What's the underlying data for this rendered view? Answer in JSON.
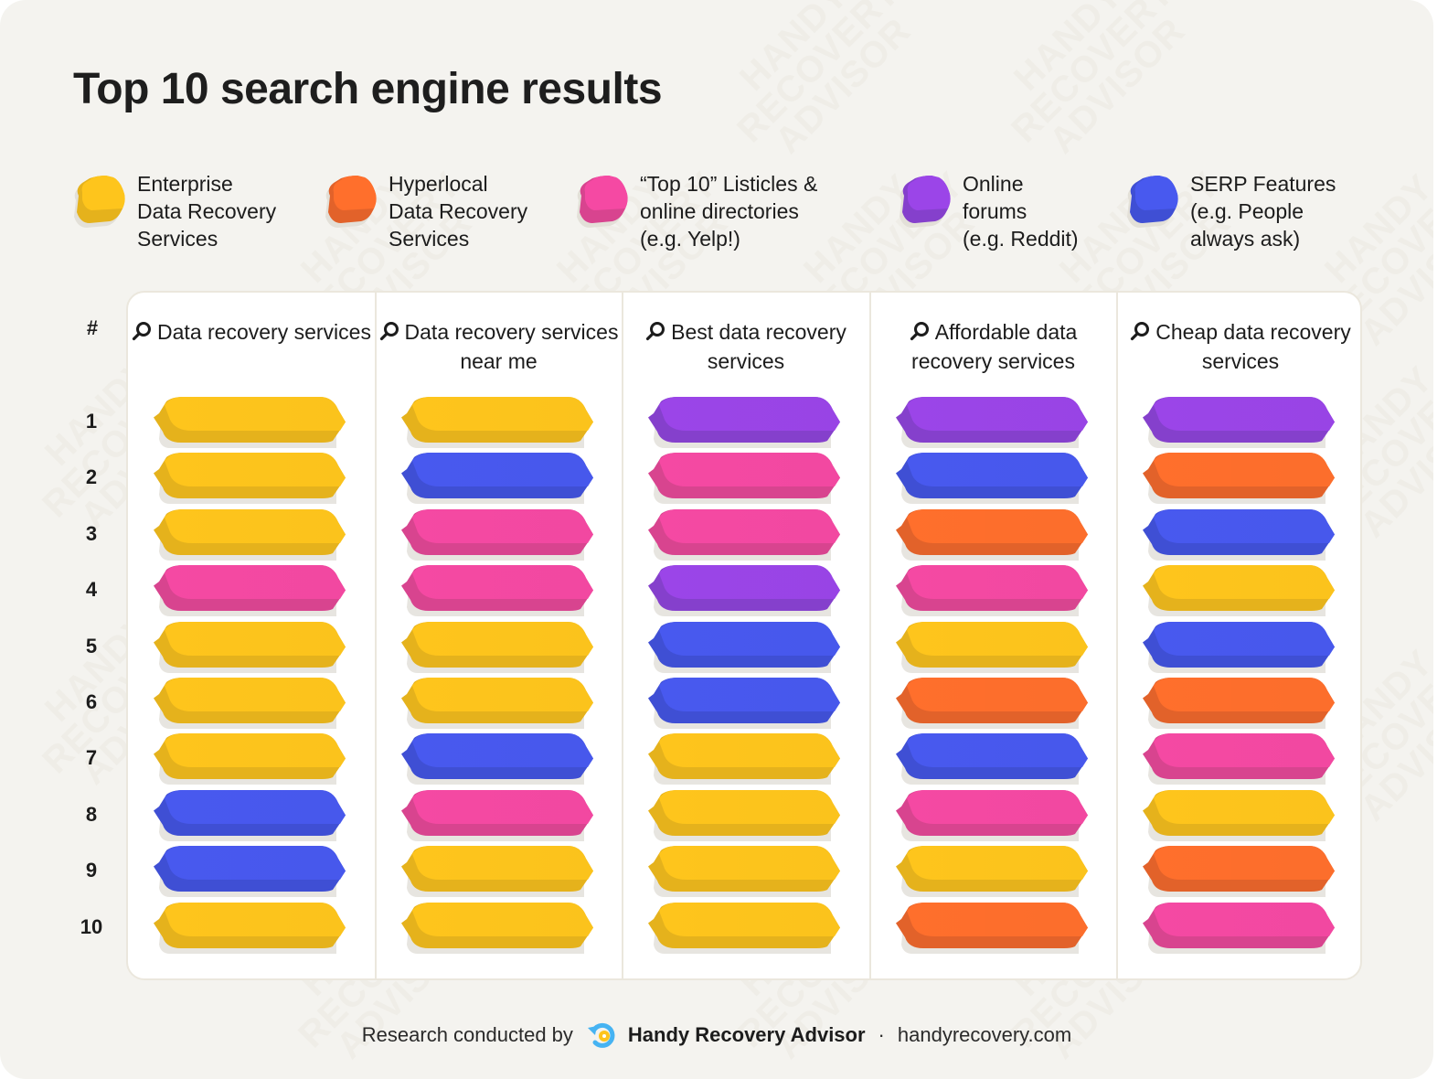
{
  "title": "Top 10 search engine results",
  "categories": {
    "enterprise": {
      "label": "Enterprise\nData Recovery\nServices",
      "color": "#fec51c",
      "shade": "#e5b21c"
    },
    "hyperlocal": {
      "label": "Hyperlocal\nData Recovery\nServices",
      "color": "#ff6f2c",
      "shade": "#e2622a"
    },
    "listicles": {
      "label": "“Top 10” Listicles &\nonline directories\n(e.g. Yelp!)",
      "color": "#f549a3",
      "shade": "#d8448f"
    },
    "forums": {
      "label": "Online\nforums\n(e.g. Reddit)",
      "color": "#9b45e8",
      "shade": "#8540cc"
    },
    "serp": {
      "label": "SERP Features\n(e.g. People\nalways ask)",
      "color": "#4859ef",
      "shade": "#3f4fd4"
    }
  },
  "legend_order": [
    "enterprise",
    "hyperlocal",
    "listicles",
    "forums",
    "serp"
  ],
  "rank_header": "#",
  "footer": {
    "prefix": "Research conducted by",
    "brand": "Handy Recovery Advisor",
    "separator": "·",
    "site": "handyrecovery.com"
  },
  "chart_data": {
    "type": "table",
    "title": "Top 10 search engine results",
    "row_label": "#",
    "rows": [
      "1",
      "2",
      "3",
      "4",
      "5",
      "6",
      "7",
      "8",
      "9",
      "10"
    ],
    "columns": [
      {
        "query": "Data recovery services",
        "results": [
          "enterprise",
          "enterprise",
          "enterprise",
          "listicles",
          "enterprise",
          "enterprise",
          "enterprise",
          "serp",
          "serp",
          "enterprise"
        ]
      },
      {
        "query": "Data recovery services near me",
        "results": [
          "enterprise",
          "serp",
          "listicles",
          "listicles",
          "enterprise",
          "enterprise",
          "serp",
          "listicles",
          "enterprise",
          "enterprise"
        ]
      },
      {
        "query": "Best data recovery services",
        "results": [
          "forums",
          "listicles",
          "listicles",
          "forums",
          "serp",
          "serp",
          "enterprise",
          "enterprise",
          "enterprise",
          "enterprise"
        ]
      },
      {
        "query": "Affordable data recovery services",
        "results": [
          "forums",
          "serp",
          "hyperlocal",
          "listicles",
          "enterprise",
          "hyperlocal",
          "serp",
          "listicles",
          "enterprise",
          "hyperlocal"
        ]
      },
      {
        "query": "Cheap data recovery services",
        "results": [
          "forums",
          "hyperlocal",
          "serp",
          "enterprise",
          "serp",
          "hyperlocal",
          "listicles",
          "enterprise",
          "hyperlocal",
          "listicles"
        ]
      }
    ]
  }
}
